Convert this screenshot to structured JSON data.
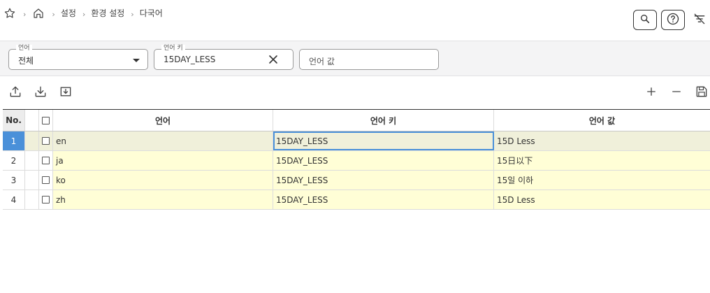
{
  "breadcrumb": {
    "items": [
      "설정",
      "환경 설정",
      "다국어"
    ],
    "separator": "›"
  },
  "top_actions": {
    "icons": [
      "search-icon",
      "help-icon",
      "filter-clear-icon"
    ]
  },
  "search": {
    "language": {
      "label": "언어",
      "value": "전체"
    },
    "language_key": {
      "label": "언어 키",
      "value": "15DAY_LESS"
    },
    "language_value": {
      "placeholder": "언어 값"
    }
  },
  "toolbar": {
    "left_icons": [
      "upload-icon",
      "download-icon",
      "download-template-icon"
    ],
    "right_icons": [
      "add-row-icon",
      "remove-row-icon",
      "save-icon"
    ]
  },
  "grid": {
    "columns": {
      "no": "No.",
      "language": "언어",
      "key": "언어 키",
      "value": "언어 값"
    },
    "rows": [
      {
        "no": "1",
        "language": "en",
        "key": "15DAY_LESS",
        "value": "15D Less"
      },
      {
        "no": "2",
        "language": "ja",
        "key": "15DAY_LESS",
        "value": "15日以下"
      },
      {
        "no": "3",
        "language": "ko",
        "key": "15DAY_LESS",
        "value": "15일 이하"
      },
      {
        "no": "4",
        "language": "zh",
        "key": "15DAY_LESS",
        "value": "15D Less"
      }
    ]
  },
  "colors": {
    "row_highlight": "#fffed6",
    "active_row": "#f0f0da",
    "selection_blue": "#4a90d9"
  }
}
